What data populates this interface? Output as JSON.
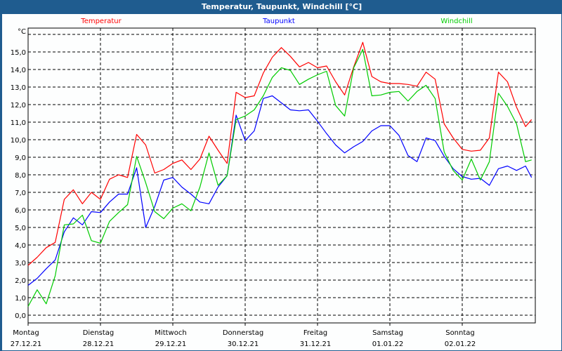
{
  "window": {
    "title": "Temperatur, Taupunkt, Windchill [°C]"
  },
  "chart_data": {
    "type": "line",
    "title": "Temperatur, Taupunkt, Windchill [°C]",
    "ylabel": "°C",
    "xlabel": "",
    "ylim": [
      -0.5,
      17
    ],
    "xlim_hours": [
      0,
      168
    ],
    "grid": true,
    "legend_placement": "top",
    "y_ticks": [
      "0,0",
      "1,0",
      "2,0",
      "3,0",
      "4,0",
      "5,0",
      "6,0",
      "7,0",
      "8,0",
      "9,0",
      "10,0",
      "11,0",
      "12,0",
      "13,0",
      "14,0",
      "15,0"
    ],
    "y_tick_values": [
      0,
      1,
      2,
      3,
      4,
      5,
      6,
      7,
      8,
      9,
      10,
      11,
      12,
      13,
      14,
      15
    ],
    "x_ticks": [
      {
        "day": "Montag",
        "date": "27.12.21"
      },
      {
        "day": "Dienstag",
        "date": "28.12.21"
      },
      {
        "day": "Mittwoch",
        "date": "29.12.21"
      },
      {
        "day": "Donnerstag",
        "date": "30.12.21"
      },
      {
        "day": "Freitag",
        "date": "31.12.21"
      },
      {
        "day": "Samstag",
        "date": "01.01.22"
      },
      {
        "day": "Sonntag",
        "date": "02.01.22"
      }
    ],
    "x_hours": [
      0,
      3,
      6,
      9,
      12,
      15,
      18,
      21,
      24,
      27,
      30,
      33,
      36,
      39,
      42,
      45,
      48,
      51,
      54,
      57,
      60,
      63,
      66,
      69,
      72,
      75,
      78,
      81,
      84,
      87,
      90,
      93,
      96,
      99,
      102,
      105,
      108,
      111,
      114,
      117,
      120,
      123,
      126,
      129,
      132,
      135,
      138,
      141,
      144,
      147,
      150,
      153,
      156,
      159,
      162,
      165,
      167
    ],
    "series": [
      {
        "name": "Temperatur",
        "color": "#ff0000",
        "values": [
          2.84,
          3.3,
          3.85,
          4.15,
          6.6,
          7.15,
          6.35,
          7.0,
          6.6,
          7.75,
          8.0,
          7.85,
          10.3,
          9.7,
          8.1,
          8.3,
          8.65,
          8.85,
          8.3,
          8.9,
          10.2,
          9.4,
          8.65,
          12.7,
          12.4,
          12.5,
          13.8,
          14.7,
          15.25,
          14.75,
          14.15,
          14.4,
          14.1,
          14.2,
          13.3,
          12.55,
          14.15,
          15.55,
          13.6,
          13.3,
          13.2,
          13.2,
          13.15,
          13.05,
          13.85,
          13.45,
          10.9,
          10.1,
          9.45,
          9.35,
          9.4,
          10.1,
          13.85,
          13.3,
          11.85,
          10.75,
          11.15
        ]
      },
      {
        "name": "Taupunkt",
        "color": "#0000ff",
        "values": [
          1.7,
          2.1,
          2.65,
          3.15,
          4.75,
          5.55,
          5.15,
          5.9,
          5.85,
          6.45,
          6.9,
          6.9,
          8.4,
          5.0,
          6.2,
          7.7,
          7.85,
          7.3,
          6.9,
          6.45,
          6.35,
          7.3,
          7.95,
          11.4,
          9.95,
          10.5,
          12.35,
          12.5,
          12.1,
          11.7,
          11.65,
          11.7,
          11.05,
          10.35,
          9.7,
          9.25,
          9.6,
          9.9,
          10.5,
          10.8,
          10.8,
          10.25,
          9.1,
          8.75,
          10.1,
          9.95,
          9.05,
          8.35,
          7.9,
          7.75,
          7.8,
          7.4,
          8.35,
          8.5,
          8.25,
          8.5,
          7.85
        ]
      },
      {
        "name": "Windchill",
        "color": "#00cc00",
        "values": [
          0.5,
          1.45,
          0.65,
          2.25,
          5.15,
          5.2,
          5.7,
          4.25,
          4.1,
          5.35,
          5.85,
          6.3,
          9.05,
          7.55,
          5.9,
          5.5,
          6.1,
          6.35,
          5.95,
          7.3,
          9.25,
          7.4,
          7.95,
          11.15,
          11.35,
          11.7,
          12.5,
          13.55,
          14.1,
          13.95,
          13.15,
          13.45,
          13.7,
          13.9,
          11.95,
          11.35,
          14.1,
          15.15,
          12.5,
          12.55,
          12.7,
          12.75,
          12.2,
          12.75,
          13.1,
          12.35,
          9.3,
          8.25,
          7.7,
          8.9,
          7.7,
          8.75,
          12.65,
          11.9,
          10.9,
          8.75,
          8.85
        ]
      }
    ]
  }
}
